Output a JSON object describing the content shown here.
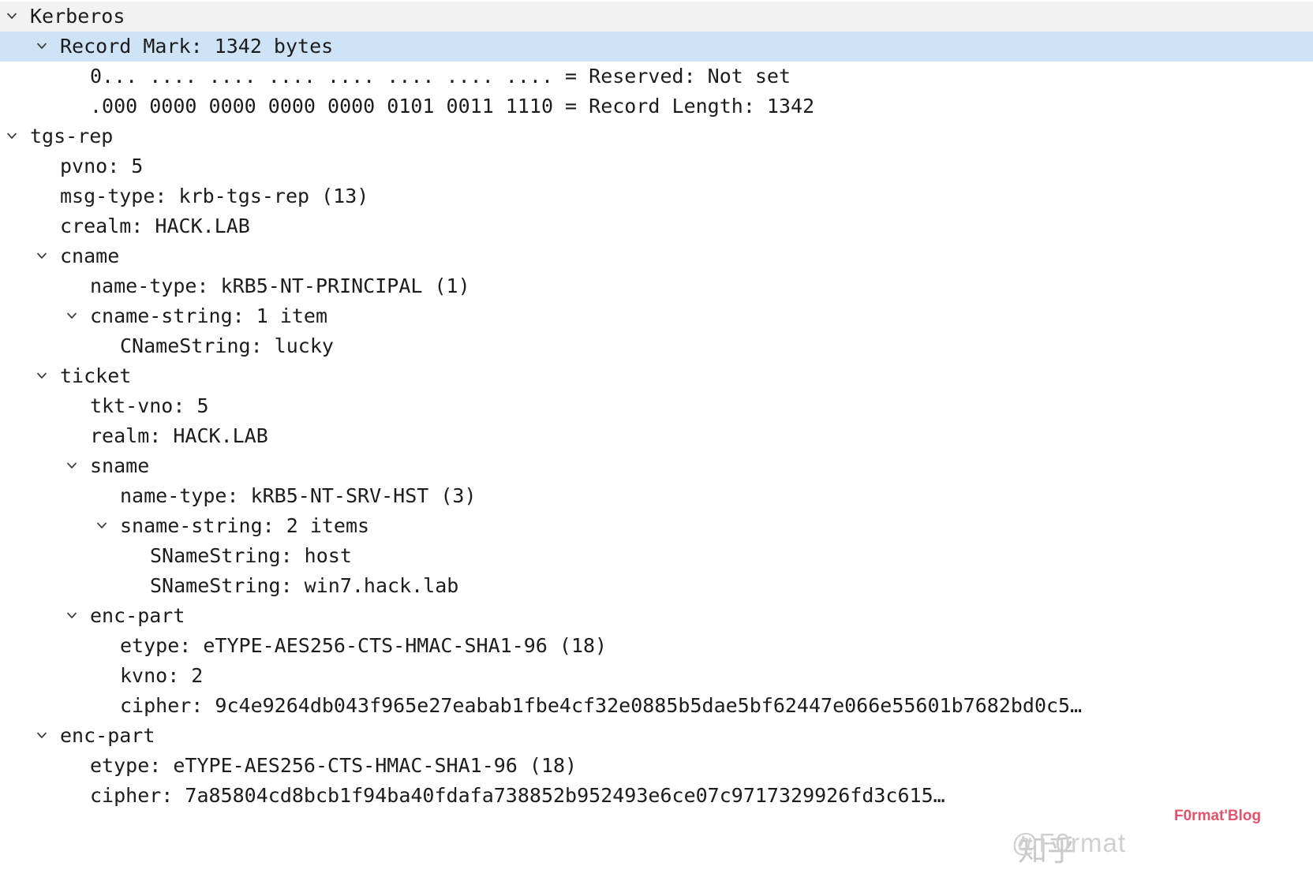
{
  "app": {
    "pane_name": "packet-details-tree",
    "protocol": "Kerberos"
  },
  "colors": {
    "selection_bg": "#cfe3f7",
    "header_bg": "#f2f2f2",
    "text": "#1c1c1c",
    "watermark_gray": "#d0d0d0",
    "watermark_red": "#e8516b"
  },
  "tree": {
    "rows": [
      {
        "id": "kerberos",
        "level": 0,
        "expander": "chevron-down-icon",
        "text": "Kerberos",
        "state": "header"
      },
      {
        "id": "record-mark",
        "level": 1,
        "expander": "chevron-down-icon",
        "text": "Record Mark: 1342 bytes",
        "state": "selected"
      },
      {
        "id": "reserved-bits",
        "level": 2,
        "expander": "none",
        "text": "0... .... .... .... .... .... .... .... = Reserved: Not set",
        "state": "normal"
      },
      {
        "id": "record-length-bits",
        "level": 2,
        "expander": "none",
        "text": ".000 0000 0000 0000 0000 0101 0011 1110 = Record Length: 1342",
        "state": "normal"
      },
      {
        "id": "tgs-rep",
        "level": 0,
        "expander": "chevron-down-icon",
        "text": "tgs-rep",
        "state": "normal"
      },
      {
        "id": "pvno",
        "level": 1,
        "expander": "none",
        "text": "pvno: 5",
        "state": "normal"
      },
      {
        "id": "msg-type",
        "level": 1,
        "expander": "none",
        "text": "msg-type: krb-tgs-rep (13)",
        "state": "normal"
      },
      {
        "id": "crealm",
        "level": 1,
        "expander": "none",
        "text": "crealm: HACK.LAB",
        "state": "normal"
      },
      {
        "id": "cname",
        "level": 1,
        "expander": "chevron-down-icon",
        "text": "cname",
        "state": "normal"
      },
      {
        "id": "cname-name-type",
        "level": 2,
        "expander": "none",
        "text": "name-type: kRB5-NT-PRINCIPAL (1)",
        "state": "normal"
      },
      {
        "id": "cname-string",
        "level": 2,
        "expander": "chevron-down-icon",
        "text": "cname-string: 1 item",
        "state": "normal"
      },
      {
        "id": "cnamestring-lucky",
        "level": 3,
        "expander": "none",
        "text": "CNameString: lucky",
        "state": "normal"
      },
      {
        "id": "ticket",
        "level": 1,
        "expander": "chevron-down-icon",
        "text": "ticket",
        "state": "normal"
      },
      {
        "id": "tkt-vno",
        "level": 2,
        "expander": "none",
        "text": "tkt-vno: 5",
        "state": "normal"
      },
      {
        "id": "ticket-realm",
        "level": 2,
        "expander": "none",
        "text": "realm: HACK.LAB",
        "state": "normal"
      },
      {
        "id": "sname",
        "level": 2,
        "expander": "chevron-down-icon",
        "text": "sname",
        "state": "normal"
      },
      {
        "id": "sname-name-type",
        "level": 3,
        "expander": "none",
        "text": "name-type: kRB5-NT-SRV-HST (3)",
        "state": "normal"
      },
      {
        "id": "sname-string",
        "level": 3,
        "expander": "chevron-down-icon",
        "text": "sname-string: 2 items",
        "state": "normal"
      },
      {
        "id": "snamestring-host",
        "level": 4,
        "expander": "none",
        "text": "SNameString: host",
        "state": "normal"
      },
      {
        "id": "snamestring-win7",
        "level": 4,
        "expander": "none",
        "text": "SNameString: win7.hack.lab",
        "state": "normal"
      },
      {
        "id": "ticket-enc-part",
        "level": 2,
        "expander": "chevron-down-icon",
        "text": "enc-part",
        "state": "normal"
      },
      {
        "id": "ticket-etype",
        "level": 3,
        "expander": "none",
        "text": "etype: eTYPE-AES256-CTS-HMAC-SHA1-96 (18)",
        "state": "normal"
      },
      {
        "id": "ticket-kvno",
        "level": 3,
        "expander": "none",
        "text": "kvno: 2",
        "state": "normal"
      },
      {
        "id": "ticket-cipher",
        "level": 3,
        "expander": "none",
        "text": "cipher: 9c4e9264db043f965e27eabab1fbe4cf32e0885b5dae5bf62447e066e55601b7682bd0c5…",
        "state": "normal"
      },
      {
        "id": "outer-enc-part",
        "level": 1,
        "expander": "chevron-down-icon",
        "text": "enc-part",
        "state": "normal"
      },
      {
        "id": "outer-etype",
        "level": 2,
        "expander": "none",
        "text": "etype: eTYPE-AES256-CTS-HMAC-SHA1-96 (18)",
        "state": "normal"
      },
      {
        "id": "outer-cipher",
        "level": 2,
        "expander": "none",
        "text": "cipher: 7a85804cd8bcb1f94ba40fdafa738852b952493e6ce07c9717329926fd3c615…",
        "state": "normal"
      }
    ]
  },
  "watermarks": {
    "zhihu": "@F0rmat",
    "zhihu_cn": "知乎",
    "blog": "F0rmat'Blog"
  }
}
